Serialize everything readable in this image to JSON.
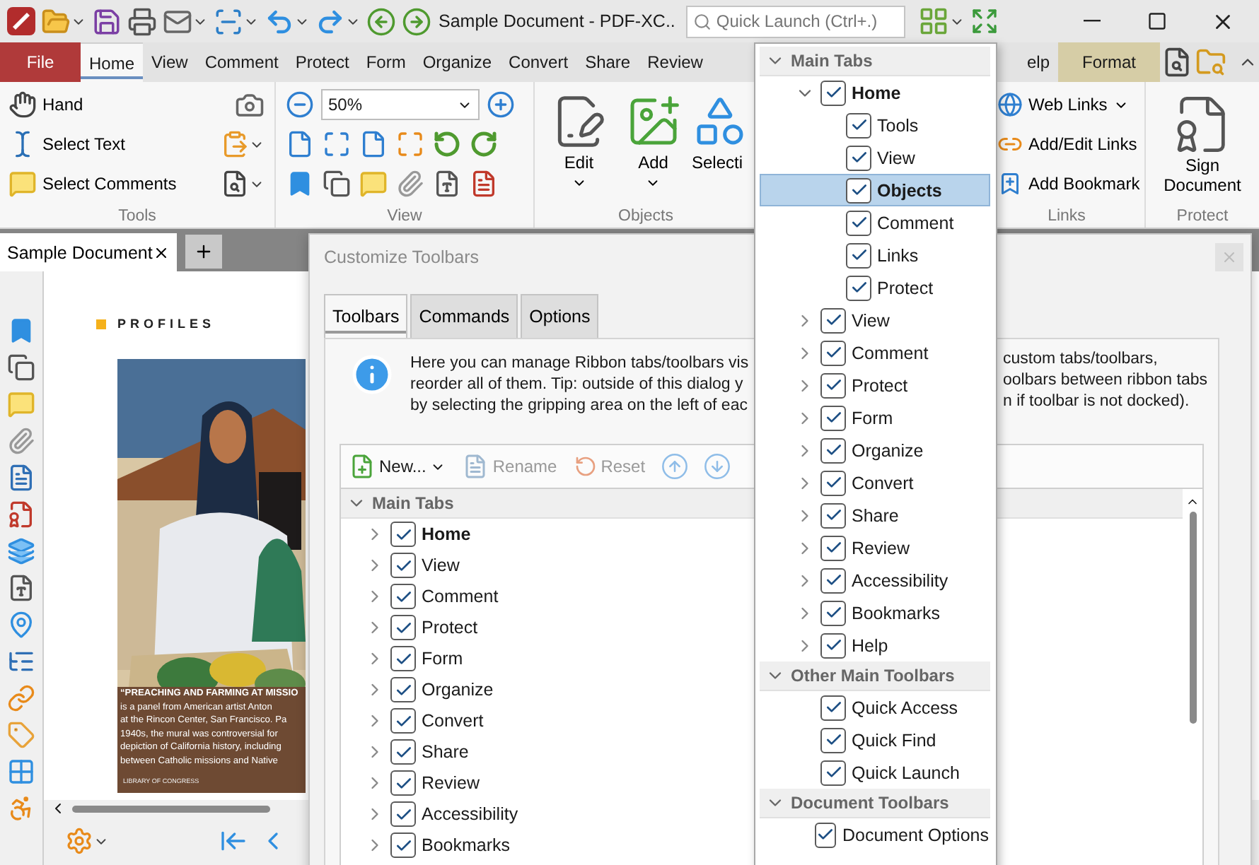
{
  "title_bar": {
    "title": "Sample Document - PDF-XC..",
    "quick_launch": {
      "placeholder": "Quick Launch (Ctrl+.)"
    }
  },
  "ribbon_tabs": [
    {
      "label": "File",
      "kind": "file",
      "selected": false
    },
    {
      "label": "Home",
      "kind": "tab",
      "selected": true
    },
    {
      "label": "View",
      "kind": "tab",
      "selected": false
    },
    {
      "label": "Comment",
      "kind": "tab",
      "selected": false
    },
    {
      "label": "Protect",
      "kind": "tab",
      "selected": false
    },
    {
      "label": "Form",
      "kind": "tab",
      "selected": false
    },
    {
      "label": "Organize",
      "kind": "tab",
      "selected": false
    },
    {
      "label": "Convert",
      "kind": "tab",
      "selected": false
    },
    {
      "label": "Share",
      "kind": "tab",
      "selected": false
    },
    {
      "label": "Review",
      "kind": "tab",
      "selected": false
    }
  ],
  "ribbon_tabs_right": [
    {
      "label": "elp",
      "kind": "tab",
      "selected": false
    },
    {
      "label": "Format",
      "kind": "context",
      "selected": false
    }
  ],
  "ribbon": {
    "tools": {
      "label": "Tools",
      "items": [
        "Hand",
        "Select Text",
        "Select Comments"
      ]
    },
    "view": {
      "label": "View",
      "zoom": "50%"
    },
    "objects": {
      "label": "Objects",
      "buttons": [
        "Edit",
        "Add",
        "Selecti"
      ]
    },
    "links": {
      "label": "Links",
      "items": [
        "Web Links",
        "Add/Edit Links",
        "Add Bookmark"
      ]
    },
    "protect": {
      "label": "Protect",
      "button": "Sign Document"
    }
  },
  "document_tabs": [
    {
      "label": "Sample Document",
      "selected": true
    }
  ],
  "page": {
    "heading": "PROFILES",
    "caption": "**“PREACHING AND FARMING AT MISSIO**\nis a panel from American artist Anton\nat the Rincon Center, San Francisco. Pa\n1940s, the mural was controversial for\ndepiction of California history, including\nbetween Catholic missions and Native",
    "credit": "LIBRARY OF CONGRESS"
  },
  "dialog": {
    "title": "Customize Toolbars",
    "tabs": [
      {
        "label": "Toolbars",
        "selected": true
      },
      {
        "label": "Commands",
        "selected": false
      },
      {
        "label": "Options",
        "selected": false
      }
    ],
    "info_left": "Here you can manage Ribbon tabs/toolbars vis\nreorder all of them. Tip: outside of this dialog y\nby selecting the gripping area on the left of eac",
    "info_right": "custom tabs/toolbars,\noolbars between ribbon tabs\nn if toolbar is not docked).",
    "toolbar": [
      {
        "label": "New...",
        "kind": "new",
        "disabled": false
      },
      {
        "label": "Rename",
        "kind": "rename",
        "disabled": true
      },
      {
        "label": "Reset",
        "kind": "reset",
        "disabled": true
      }
    ],
    "tree_header": "Main Tabs",
    "tree": [
      {
        "label": "Home",
        "checked": true,
        "current": true
      },
      {
        "label": "View",
        "checked": true,
        "current": false
      },
      {
        "label": "Comment",
        "checked": true,
        "current": false
      },
      {
        "label": "Protect",
        "checked": true,
        "current": false
      },
      {
        "label": "Form",
        "checked": true,
        "current": false
      },
      {
        "label": "Organize",
        "checked": true,
        "current": false
      },
      {
        "label": "Convert",
        "checked": true,
        "current": false
      },
      {
        "label": "Share",
        "checked": true,
        "current": false
      },
      {
        "label": "Review",
        "checked": true,
        "current": false
      },
      {
        "label": "Accessibility",
        "checked": true,
        "current": false
      },
      {
        "label": "Bookmarks",
        "checked": true,
        "current": false
      }
    ]
  },
  "dropdown": {
    "sections": [
      {
        "label": "Main Tabs",
        "expanded": true,
        "items": [
          {
            "label": "Home",
            "checked": true,
            "expanded": true,
            "current": true,
            "selected": false,
            "children": [
              {
                "label": "Tools",
                "checked": true,
                "selected": false
              },
              {
                "label": "View",
                "checked": true,
                "selected": false
              },
              {
                "label": "Objects",
                "checked": true,
                "selected": true
              },
              {
                "label": "Comment",
                "checked": true,
                "selected": false
              },
              {
                "label": "Links",
                "checked": true,
                "selected": false
              },
              {
                "label": "Protect",
                "checked": true,
                "selected": false
              }
            ]
          },
          {
            "label": "View",
            "checked": true,
            "expanded": false,
            "current": false,
            "selected": false
          },
          {
            "label": "Comment",
            "checked": true,
            "expanded": false,
            "current": false,
            "selected": false
          },
          {
            "label": "Protect",
            "checked": true,
            "expanded": false,
            "current": false,
            "selected": false
          },
          {
            "label": "Form",
            "checked": true,
            "expanded": false,
            "current": false,
            "selected": false
          },
          {
            "label": "Organize",
            "checked": true,
            "expanded": false,
            "current": false,
            "selected": false
          },
          {
            "label": "Convert",
            "checked": true,
            "expanded": false,
            "current": false,
            "selected": false
          },
          {
            "label": "Share",
            "checked": true,
            "expanded": false,
            "current": false,
            "selected": false
          },
          {
            "label": "Review",
            "checked": true,
            "expanded": false,
            "current": false,
            "selected": false
          },
          {
            "label": "Accessibility",
            "checked": true,
            "expanded": false,
            "current": false,
            "selected": false
          },
          {
            "label": "Bookmarks",
            "checked": true,
            "expanded": false,
            "current": false,
            "selected": false
          },
          {
            "label": "Help",
            "checked": true,
            "expanded": false,
            "current": false,
            "selected": false
          }
        ]
      },
      {
        "label": "Other Main Toolbars",
        "expanded": true,
        "items": [
          {
            "label": "Quick Access",
            "checked": true,
            "current": false,
            "selected": false
          },
          {
            "label": "Quick Find",
            "checked": true,
            "current": false,
            "selected": false
          },
          {
            "label": "Quick Launch",
            "checked": true,
            "current": false,
            "selected": false
          }
        ]
      },
      {
        "label": "Document Toolbars",
        "expanded": true,
        "items": [
          {
            "label": "Document Options",
            "checked": true,
            "current": false,
            "selected": false
          }
        ]
      }
    ]
  }
}
